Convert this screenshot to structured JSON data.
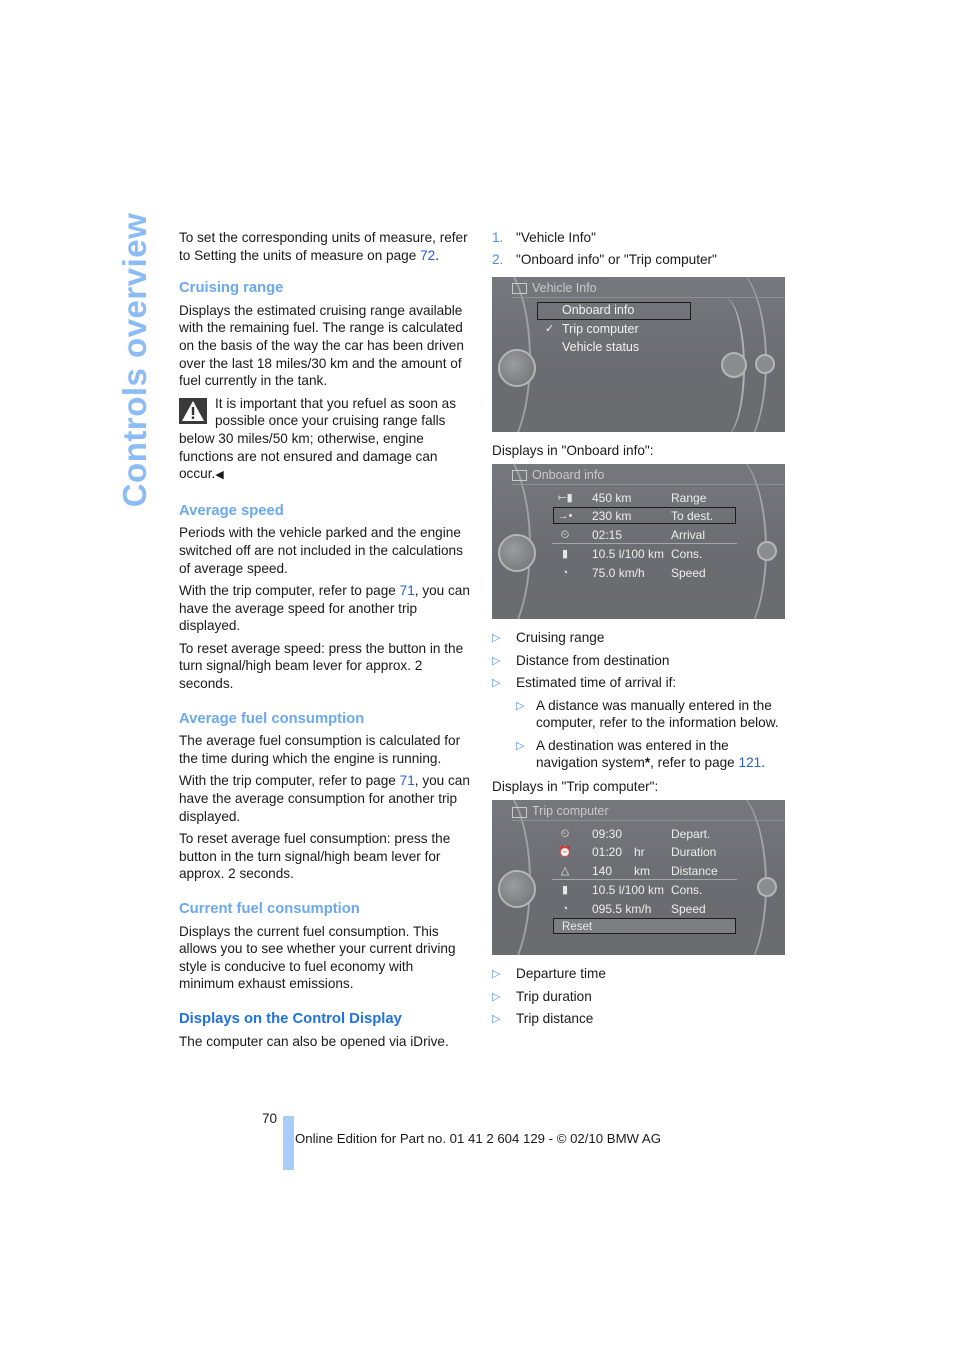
{
  "side_tab": "Controls overview",
  "left": {
    "intro": {
      "pre": "To set the corresponding units of measure, refer to Setting the units of measure on page ",
      "link": "72",
      "post": "."
    },
    "cruising": {
      "heading": "Cruising range",
      "body": "Displays the estimated cruising range available with the remaining fuel. The range is calculated on the basis of the way the car has been driven over the last 18 miles/30 km and the amount of fuel currently in the tank.",
      "warning": "It is important that you refuel as soon as possible once your cruising range falls below 30 miles/50 km; otherwise, engine functions are not ensured and damage can occur.",
      "end_mark": "◀"
    },
    "avg_speed": {
      "heading": "Average speed",
      "p1": "Periods with the vehicle parked and the engine switched off are not included in the calculations of average speed.",
      "p2_pre": "With the trip computer, refer to page ",
      "p2_link": "71",
      "p2_post": ", you can have the average speed for another trip displayed.",
      "p3": "To reset average speed: press the button in the turn signal/high beam lever for approx. 2 seconds."
    },
    "avg_fuel": {
      "heading": "Average fuel consumption",
      "p1": "The average fuel consumption is calculated for the time during which the engine is running.",
      "p2_pre": "With the trip computer, refer to page ",
      "p2_link": "71",
      "p2_post": ", you can have the average consumption for another trip displayed.",
      "p3": "To reset average fuel consumption: press the button in the turn signal/high beam lever for approx. 2 seconds."
    },
    "current_fuel": {
      "heading": "Current fuel consumption",
      "body": "Displays the current fuel consumption. This allows you to see whether your current driving style is conducive to fuel economy with minimum exhaust emissions."
    },
    "control_display": {
      "heading": "Displays on the Control Display",
      "body": "The computer can also be opened via iDrive."
    }
  },
  "right": {
    "steps": [
      {
        "num": "1.",
        "text": "\"Vehicle Info\""
      },
      {
        "num": "2.",
        "text": "\"Onboard info\" or \"Trip computer\""
      }
    ],
    "screen1": {
      "title": "Vehicle Info",
      "items": [
        "Onboard info",
        "Trip computer",
        "Vehicle status"
      ],
      "check": "✓"
    },
    "caption_onboard": "Displays in \"Onboard info\":",
    "screen2": {
      "title": "Onboard info",
      "rows": [
        {
          "icon": "⇽▮",
          "value": "450  km",
          "label": "Range"
        },
        {
          "icon": "→•",
          "value": "230  km",
          "label": "To dest."
        },
        {
          "icon": "⏲",
          "value": "02:15",
          "label": "Arrival"
        },
        {
          "icon": "▮",
          "value": "10.5 l/100 km",
          "label": "Cons."
        },
        {
          "icon": "◔",
          "value": "75.0 km/h",
          "label": "Speed"
        }
      ]
    },
    "onboard_list": [
      "Cruising range",
      "Distance from destination",
      "Estimated time of arrival if:"
    ],
    "arrival_sub": [
      {
        "text": "A distance was manually entered in the computer, refer to the information below."
      },
      {
        "pre": "A destination was entered in the navigation system",
        "star": "*",
        "mid": ", refer to page ",
        "link": "121",
        "post": "."
      }
    ],
    "caption_trip": "Displays in \"Trip computer\":",
    "screen3": {
      "title": "Trip computer",
      "rows": [
        {
          "icon": "⏲",
          "value": "09:30",
          "unit": "",
          "label": "Depart."
        },
        {
          "icon": "⏰",
          "value": "01:20",
          "unit": "hr",
          "label": "Duration"
        },
        {
          "icon": "△",
          "value": "140",
          "unit": "km",
          "label": "Distance"
        },
        {
          "icon": "▮",
          "value": "10.5 l/100 km",
          "unit": "",
          "label": "Cons."
        },
        {
          "icon": "◔",
          "value": "095.5 km/h",
          "unit": "",
          "label": "Speed"
        }
      ],
      "reset": "Reset"
    },
    "trip_list": [
      "Departure time",
      "Trip duration",
      "Trip distance"
    ],
    "bullet": "▷"
  },
  "footer": {
    "page": "70",
    "text": "Online Edition for Part no. 01 41 2 604 129 - © 02/10 BMW AG"
  }
}
